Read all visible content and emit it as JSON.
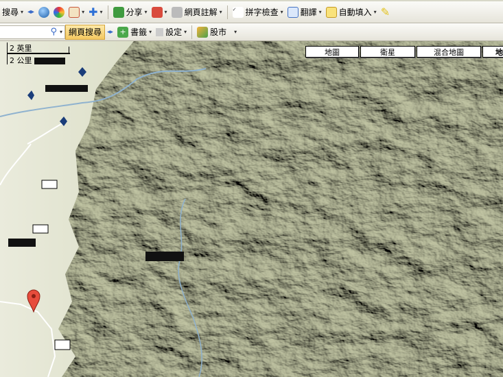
{
  "toolbar": {
    "search_fragment": "搜尋",
    "share": "分享",
    "annotate": "網頁註解",
    "spellcheck": "拼字檢查",
    "translate": "翻譯",
    "autofill": "自動填入",
    "web_search": "網頁搜尋",
    "bookmarks": "書籤",
    "settings": "設定",
    "stocks": "股市"
  },
  "map": {
    "scale_imperial": "2 英里",
    "scale_metric": "2 公里",
    "types": [
      "地圖",
      "衛星",
      "混合地圖",
      "地形"
    ],
    "active_type": "地形",
    "marker_color": "#e74c3c"
  },
  "icons": [
    "search-icon",
    "globe-icon",
    "share-icon",
    "translate-icon",
    "autofill-icon",
    "map-pin-icon"
  ]
}
